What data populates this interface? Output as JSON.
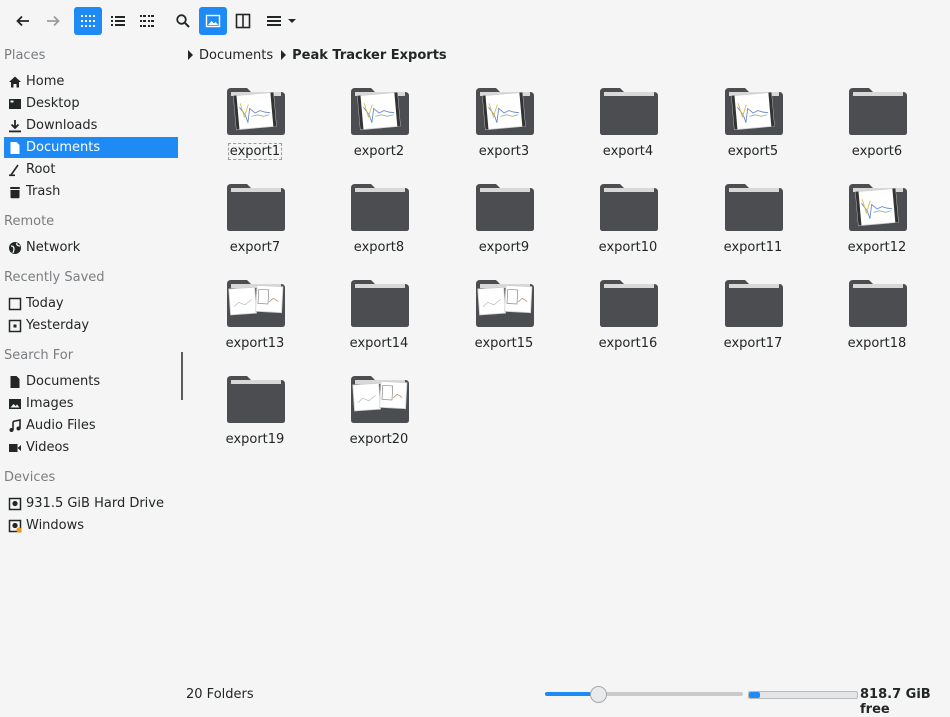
{
  "toolbar": {
    "back_icon": "arrow-left-icon",
    "forward_icon": "arrow-right-icon",
    "view_modes": [
      "icons",
      "details",
      "compact"
    ],
    "active_view": "icons",
    "search_icon": "search-icon",
    "preview_icon": "image-icon",
    "split_icon": "split-view-icon",
    "menu_icon": "hamburger-icon"
  },
  "sidebar": {
    "places_label": "Places",
    "places": [
      {
        "label": "Home",
        "icon": "home-icon"
      },
      {
        "label": "Desktop",
        "icon": "desktop-icon"
      },
      {
        "label": "Downloads",
        "icon": "download-icon"
      },
      {
        "label": "Documents",
        "icon": "document-icon",
        "selected": true
      },
      {
        "label": "Root",
        "icon": "root-icon"
      },
      {
        "label": "Trash",
        "icon": "trash-icon"
      }
    ],
    "remote_label": "Remote",
    "remote": [
      {
        "label": "Network",
        "icon": "network-icon"
      }
    ],
    "recent_label": "Recently Saved",
    "recent": [
      {
        "label": "Today",
        "icon": "calendar-icon"
      },
      {
        "label": "Yesterday",
        "icon": "calendar-icon"
      }
    ],
    "search_label": "Search For",
    "search": [
      {
        "label": "Documents",
        "icon": "document-icon"
      },
      {
        "label": "Images",
        "icon": "image-icon"
      },
      {
        "label": "Audio Files",
        "icon": "music-icon"
      },
      {
        "label": "Videos",
        "icon": "video-icon"
      }
    ],
    "devices_label": "Devices",
    "devices": [
      {
        "label": "931.5 GiB Hard Drive",
        "icon": "drive-icon"
      },
      {
        "label": "Windows",
        "icon": "drive-icon"
      }
    ]
  },
  "breadcrumb": {
    "parent": "Documents",
    "current": "Peak Tracker Exports"
  },
  "folders": [
    {
      "name": "export1",
      "preview": "chart",
      "focused": true
    },
    {
      "name": "export2",
      "preview": "chart"
    },
    {
      "name": "export3",
      "preview": "chart"
    },
    {
      "name": "export4",
      "preview": "none"
    },
    {
      "name": "export5",
      "preview": "chart"
    },
    {
      "name": "export6",
      "preview": "none"
    },
    {
      "name": "export7",
      "preview": "none"
    },
    {
      "name": "export8",
      "preview": "none"
    },
    {
      "name": "export9",
      "preview": "none"
    },
    {
      "name": "export10",
      "preview": "none"
    },
    {
      "name": "export11",
      "preview": "none"
    },
    {
      "name": "export12",
      "preview": "chart"
    },
    {
      "name": "export13",
      "preview": "dual"
    },
    {
      "name": "export14",
      "preview": "none"
    },
    {
      "name": "export15",
      "preview": "dual"
    },
    {
      "name": "export16",
      "preview": "none"
    },
    {
      "name": "export17",
      "preview": "none"
    },
    {
      "name": "export18",
      "preview": "none"
    },
    {
      "name": "export19",
      "preview": "none"
    },
    {
      "name": "export20",
      "preview": "dual"
    }
  ],
  "status": {
    "count_text": "20 Folders",
    "zoom_fraction": 0.27,
    "used_fraction": 0.1,
    "free_text": "818.7 GiB free"
  },
  "colors": {
    "accent": "#1e8af5",
    "folder": "#4b4d50",
    "text": "#232627"
  }
}
